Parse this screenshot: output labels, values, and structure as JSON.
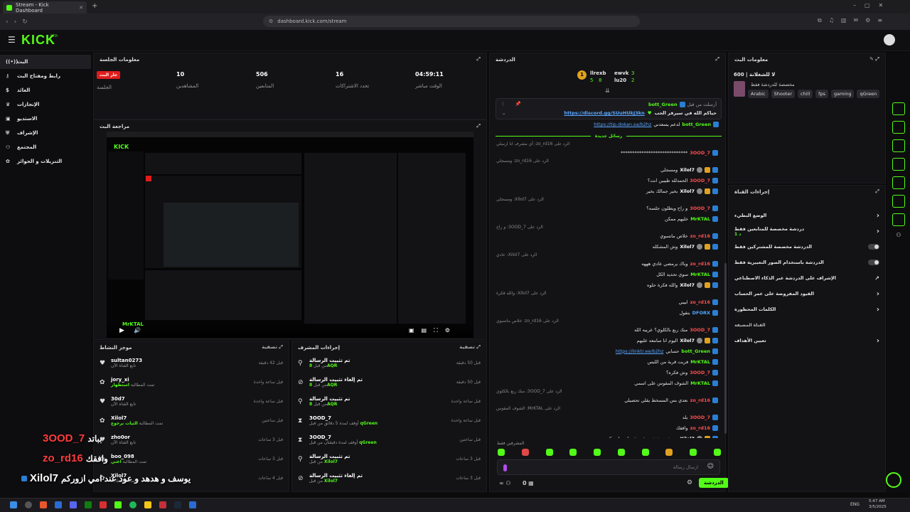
{
  "browser": {
    "tab_title": "Stream - Kick Dashboard",
    "url": "dashboard.kick.com/stream"
  },
  "brand": {
    "logo": "KICK",
    "beta": "BETA",
    "accent": "#53fc18"
  },
  "sidebar": {
    "items": [
      {
        "label": "البث",
        "icon": "broadcast-icon"
      },
      {
        "label": "رابط ومفتاح البث",
        "icon": "key-icon"
      },
      {
        "label": "العائد",
        "icon": "money-icon"
      },
      {
        "label": "الإنجازات",
        "icon": "trophy-icon"
      },
      {
        "label": "الاستديو",
        "icon": "studio-icon"
      },
      {
        "label": "الإشراف",
        "icon": "shield-icon"
      },
      {
        "label": "المجتمع",
        "icon": "community-icon"
      },
      {
        "label": "التنزيلات و الجوائز",
        "icon": "gift-icon"
      }
    ]
  },
  "session": {
    "title": "معلومات الجلسة",
    "live_badge": "جار البث",
    "live_label": "الجلسة",
    "stats": [
      {
        "value": "10",
        "label": "المشاهدين"
      },
      {
        "value": "506",
        "label": "المتابعين"
      },
      {
        "value": "16",
        "label": "تحدد الاشتراكات"
      },
      {
        "value": "04:59:11",
        "label": "الوقت مباشر"
      }
    ]
  },
  "preview": {
    "title": "مراجعة البث",
    "overlay_name": "MrKTAL"
  },
  "activity": {
    "title": "موجز النشاط",
    "filter": "تصفية",
    "rows": [
      {
        "name": "sultan0273",
        "sub": "تابع القناة الآن",
        "time": "قبل 42 دقيقة",
        "icon": "heart-icon"
      },
      {
        "name": "jory_xi",
        "sub": "تمت المطالبة",
        "highlight": "استظهار",
        "time": "قبل ساعة واحدة",
        "icon": "gift-icon"
      },
      {
        "name": "30d7",
        "sub": "تابع القناة الآن",
        "time": "قبل ساعة واحدة",
        "icon": "heart-icon"
      },
      {
        "name": "Xilol7",
        "sub": "تمت المطالبة",
        "highlight": "الثيات برجوع",
        "time": "قبل ساعتين",
        "icon": "gift-icon"
      },
      {
        "name": "zho0or",
        "sub": "تابع القناة الآن",
        "time": "قبل 3 ساعات",
        "icon": "heart-icon"
      },
      {
        "name": "boo_098",
        "sub": "تمت المطالبة",
        "highlight": "اغني",
        "time": "قبل 3 ساعات",
        "icon": "gift-icon"
      },
      {
        "name": "Xilol7",
        "sub": "تمت المطالبة",
        "time": "قبل 4 ساعات",
        "icon": "gift-icon"
      }
    ]
  },
  "modactions": {
    "title": "إجراءات المشرف",
    "filter": "تصفية",
    "rows": [
      {
        "name": "تم تثبيت الرسالة",
        "sub": "من قبل",
        "by": "8AQR",
        "time": "قبل 50 دقيقة",
        "icon": "pin-icon"
      },
      {
        "name": "تم إلغاء تثبيت الرسالة",
        "sub": "من قبل",
        "by": "8AQR",
        "time": "قبل 50 دقيقة",
        "icon": "unpin-icon"
      },
      {
        "name": "تم تثبيت الرسالة",
        "sub": "من قبل",
        "by": "8AQR",
        "time": "قبل ساعة واحدة",
        "icon": "pin-icon"
      },
      {
        "name": "3OOD_7",
        "sub": "أوقف لمدة 5 دقائق من قبل",
        "by": "qGreen",
        "time": "قبل ساعة واحدة",
        "icon": "timeout-icon"
      },
      {
        "name": "3OOD_7",
        "sub": "أوقف لمدة دقيقتان من قبل",
        "by": "qGreen",
        "time": "قبل ساعتين",
        "icon": "timeout-icon"
      },
      {
        "name": "تم تثبيت الرسالة",
        "sub": "من قبل",
        "by": "Xilol7",
        "time": "قبل 3 ساعات",
        "icon": "pin-icon"
      },
      {
        "name": "تم إلغاء تثبيت الرسالة",
        "sub": "من قبل",
        "by": "Xilol7",
        "time": "قبل 3 ساعات",
        "icon": "unpin-icon"
      }
    ]
  },
  "chat": {
    "title": "الدردشة",
    "leaderboard": [
      {
        "rank": "1",
        "name": "llrexb",
        "count": "5"
      },
      {
        "rank": "",
        "name": "ewvk",
        "count": "3"
      },
      {
        "rank": "",
        "name": "lu20",
        "count": "2"
      },
      {
        "rank": "",
        "name": "",
        "count": "8"
      }
    ],
    "pinned": {
      "label": "أرسلت من قبل",
      "user": "bott_Green",
      "text": "حياكم الله في سيرفر الحب",
      "link": "https://discord.gg/SUuHUkJ3kn"
    },
    "tip_line": {
      "user": "bott_Green",
      "text": "لدعم يسعدني",
      "link": "https://tip.dokan.sa/b2hz"
    },
    "new_messages": "رسائل جديدة",
    "messages": [
      {
        "reply": "الرد على zo_rd16: أي مشرف انا ارسلي",
        "user": "3OOD_7",
        "color": "#ff4d4d",
        "text": "*****************************"
      },
      {
        "reply": "الرد على zo_rd16: ومسجلي",
        "user": "Xilol7",
        "color": "#ffffff",
        "text": "ومسجلي",
        "badges": true
      },
      {
        "reply": "",
        "user": "3OOD_7",
        "color": "#ff4d4d",
        "text": "الحمدلله طيبين انت؟"
      },
      {
        "reply": "",
        "user": "Xilol7",
        "color": "#ffffff",
        "text": "بخير جمالك بخير",
        "badges": true
      },
      {
        "reply": "الرد على Xilol7: ومسجلي",
        "user": "3OOD_7",
        "color": "#ff4d4d",
        "text": "و راح ويطلون جلسه؟"
      },
      {
        "reply": "",
        "user": "MrKTAL",
        "color": "#53fc18",
        "text": "خليهم ممكن"
      },
      {
        "reply": "الرد على 3OOD_7: و راح",
        "user": "zo_rd16",
        "color": "#ff4d4d",
        "text": "خلاص ماتسوي"
      },
      {
        "reply": "",
        "user": "Xilol7",
        "color": "#ffffff",
        "text": "وش المشكله",
        "badges": true
      },
      {
        "reply": "الرد على Xilol7: عادي",
        "user": "zo_rd16",
        "color": "#ff4d4d",
        "text": "وياك يرمضي عادي هههه"
      },
      {
        "reply": "",
        "user": "MrKTAL",
        "color": "#53fc18",
        "text": "سوي تحديد الكل"
      },
      {
        "reply": "",
        "user": "Xilol7",
        "color": "#ffffff",
        "text": "والله فكرة حلوه",
        "badges": true
      },
      {
        "reply": "الرد على Xilol7: والله فكرة",
        "user": "zo_rd16",
        "color": "#ff4d4d",
        "text": "ابيبي"
      },
      {
        "reply": "",
        "user": "DFORX",
        "color": "#4da6ff",
        "text": "بتقول"
      },
      {
        "reply": "الرد على zo_rd16: خلاص ماتسوي",
        "user": "3OOD_7",
        "color": "#ff4d4d",
        "text": "منك ربع بالكلوي؟ عريبه الله"
      },
      {
        "reply": "",
        "user": "Xilol7",
        "color": "#ffffff",
        "text": "اليوم انا سامعه عليهم",
        "badges": true
      },
      {
        "reply": "",
        "user": "bott_Green",
        "color": "#53fc18",
        "text": "حسابي",
        "link": "https://linktr.ee/b2hz"
      },
      {
        "reply": "",
        "user": "MrKTAL",
        "color": "#53fc18",
        "text": "فريت قربة من اللبس"
      },
      {
        "reply": "",
        "user": "3OOD_7",
        "color": "#ff4d4d",
        "text": "وش فكره؟"
      },
      {
        "reply": "",
        "user": "MrKTAL",
        "color": "#53fc18",
        "text": "الشوف المقوس على اسمي"
      },
      {
        "reply": "الرد على 3OOD_7: منك ربع بالكلوي",
        "user": "zo_rd16",
        "color": "#ff4d4d",
        "text": "نعدي بس المسخط يقلي تحصيلي"
      },
      {
        "reply": "الرد على MrKTAL: الشوف المقوس",
        "user": "3OOD_7",
        "color": "#ff4d4d",
        "text": "يلد"
      },
      {
        "reply": "",
        "user": "zo_rd16",
        "color": "#ff4d4d",
        "text": "وافقك"
      },
      {
        "reply": "",
        "user": "Xilol7",
        "color": "#ffffff",
        "text": "يوسف و هدهد و عود عند امي ازوركم",
        "badges": true
      }
    ],
    "mods_only": "المشرفين فقط",
    "input_placeholder": "ارسال رسالة",
    "send_button": "الدردشة",
    "footer_count": "0"
  },
  "stream_info": {
    "title": "معلومات البث",
    "stream_title": "لا للشغلانة | 600",
    "category": "مخصصة للدردشة فقط",
    "tags": [
      "Arabic",
      "Shooter",
      "chill",
      "fps",
      "gaming",
      "qGreen"
    ]
  },
  "channel_actions": {
    "title": "إجراءات القناة",
    "rows": [
      {
        "label": "الوضع البطيء",
        "control": "chevron"
      },
      {
        "label": "دردشة مخصصة للمتابعين فقط",
        "sub": "1 د",
        "control": "chevron"
      },
      {
        "label": "الدردشة مخصصة للمشتركين فقط",
        "control": "toggle"
      },
      {
        "label": "الدردشة باستخدام الصور التعبيرية فقط",
        "control": "toggle"
      },
      {
        "label": "الإشراف على الدردشة عبر الذكاء الاصطناعي",
        "control": "external"
      },
      {
        "label": "القيود المفروضة على عمر الحساب",
        "control": "chevron"
      },
      {
        "label": "الكلمات المحظورة",
        "control": "chevron"
      },
      {
        "label": "القناة المضيفة",
        "control": "none"
      },
      {
        "label": "تعيين الأهداف",
        "control": "chevron"
      }
    ]
  },
  "overlay": {
    "lines": [
      {
        "name": "3OOD_7",
        "text": "بباتد",
        "color": "#ff3b3b"
      },
      {
        "name": "zo_rd16",
        "text": "وافقك",
        "color": "#ff3b3b"
      },
      {
        "name": "Xilol7",
        "text": "يوسف و هدهد و عود عند امي ازوركم",
        "color": "#ffffff"
      }
    ]
  },
  "taskbar": {
    "lang": "ENG",
    "time": "5:47 AM",
    "date": "3/5/2025"
  }
}
